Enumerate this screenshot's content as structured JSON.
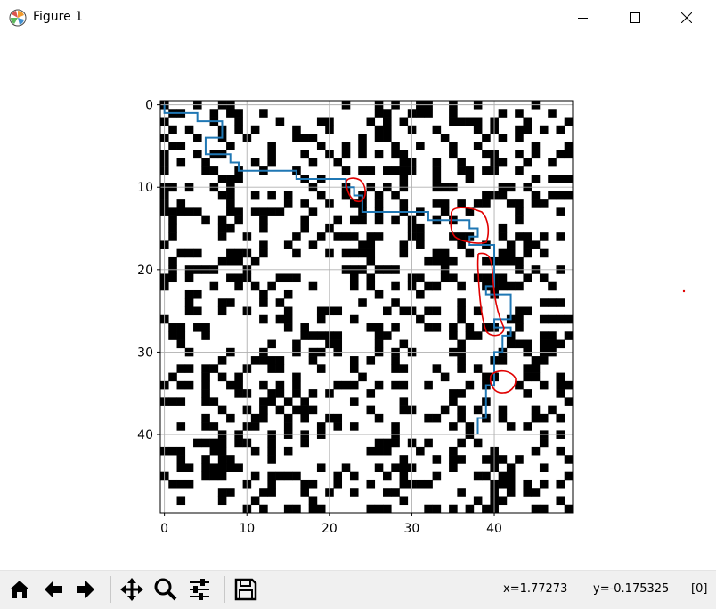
{
  "window": {
    "title": "Figure 1",
    "icons": {
      "app": "matplotlib-icon",
      "minimize": "minimize-icon",
      "maximize": "maximize-icon",
      "close": "close-icon"
    }
  },
  "figure": {
    "grid": true,
    "image": {
      "rows": 50,
      "cols": 50,
      "colormap": "binary",
      "seed": 7
    },
    "path_color": "#1f77b4",
    "annotation_color": "#e00000",
    "chart_data": {
      "type": "line",
      "title": "",
      "xlabel": "",
      "ylabel": "",
      "xlim": [
        -0.5,
        49.5
      ],
      "ylim": [
        49.5,
        -0.5
      ],
      "x_ticks": [
        "0",
        "10",
        "20",
        "30",
        "40"
      ],
      "y_ticks": [
        "0",
        "10",
        "20",
        "30",
        "40"
      ],
      "series": [
        {
          "x": [
            0,
            0,
            4,
            4,
            7,
            7,
            5,
            5,
            8,
            8,
            9,
            9,
            16,
            16,
            22,
            22,
            23,
            23,
            24,
            24,
            32,
            32,
            37,
            37,
            38,
            38,
            37,
            37,
            40,
            40,
            39,
            39,
            42,
            42,
            40,
            40,
            42,
            42,
            41,
            41,
            40,
            40,
            39,
            39,
            38,
            38
          ],
          "y": [
            0,
            1,
            1,
            2,
            2,
            4,
            4,
            6,
            6,
            7,
            7,
            8,
            8,
            9,
            9,
            10,
            10,
            11,
            11,
            13,
            13,
            14,
            14,
            15,
            15,
            16,
            16,
            17,
            17,
            22,
            22,
            23,
            23,
            26,
            26,
            27,
            27,
            28,
            28,
            30,
            30,
            34,
            34,
            38,
            38,
            40
          ]
        }
      ]
    }
  },
  "toolbar": {
    "buttons": [
      {
        "name": "home-button",
        "icon": "home-icon"
      },
      {
        "name": "back-button",
        "icon": "arrow-left-icon"
      },
      {
        "name": "forward-button",
        "icon": "arrow-right-icon"
      },
      {
        "name": "pan-button",
        "icon": "pan-icon"
      },
      {
        "name": "zoom-button",
        "icon": "zoom-icon"
      },
      {
        "name": "configure-subplots-button",
        "icon": "sliders-icon"
      },
      {
        "name": "save-button",
        "icon": "save-icon"
      }
    ],
    "status": {
      "x": "x=1.77273",
      "y": "y=-0.175325",
      "value": "[0]"
    }
  }
}
